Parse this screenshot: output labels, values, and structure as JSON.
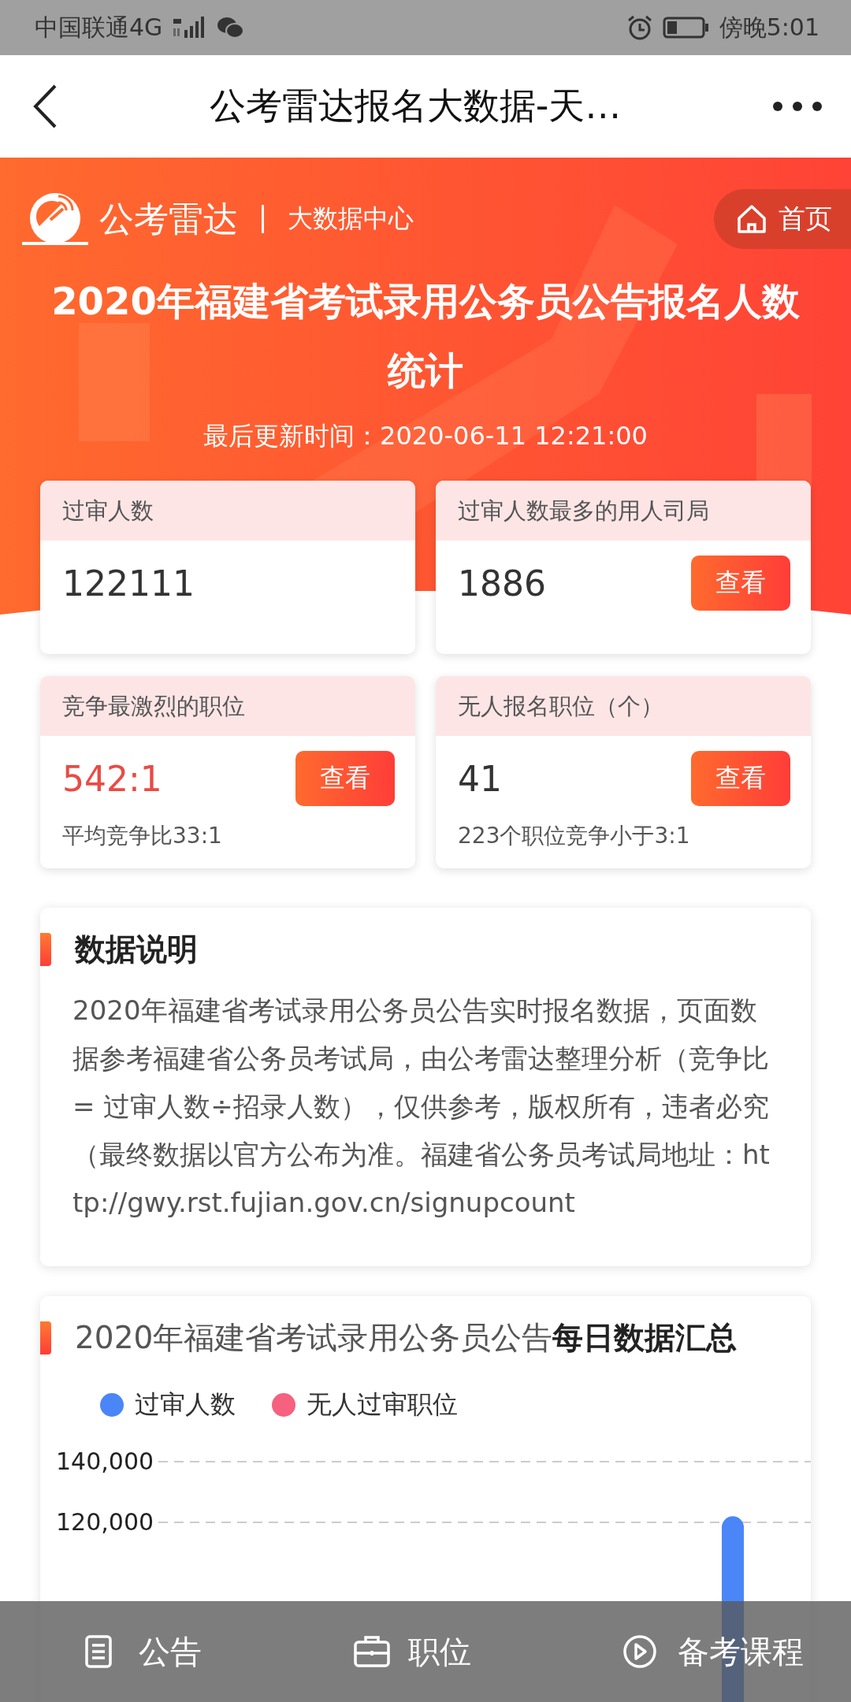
{
  "status_bar": {
    "carrier": "中国联通4G",
    "time": "傍晚5:01"
  },
  "nav": {
    "title": "公考雷达报名大数据-天…"
  },
  "header": {
    "brand": "公考雷达",
    "section": "大数据中心",
    "home": "首页",
    "title": "2020年福建省考试录用公务员公告报名人数统计",
    "updated": "最后更新时间：2020-06-11 12:21:00"
  },
  "stats": [
    {
      "label": "过审人数",
      "value": "122111",
      "highlight": false
    },
    {
      "label": "过审人数最多的用人司局",
      "value": "1886",
      "highlight": false,
      "button": "查看"
    },
    {
      "label": "竞争最激烈的职位",
      "value": "542:1",
      "highlight": true,
      "button": "查看",
      "note": "平均竞争比33:1"
    },
    {
      "label": "无人报名职位（个）",
      "value": "41",
      "highlight": false,
      "button": "查看",
      "note": "223个职位竞争小于3:1"
    }
  ],
  "notice": {
    "title": "数据说明",
    "text": "2020年福建省考试录用公务员公告实时报名数据，页面数据参考福建省公务员考试局，由公考雷达整理分析（竞争比 = 过审人数÷招录人数），仅供参考，版权所有，违者必究（最终数据以官方公布为准。福建省公务员考试局地址：http://gwy.rst.fujian.gov.cn/signupcount"
  },
  "daily": {
    "title": "2020年福建省考试录用公务员公告**每日数据汇总**",
    "chart_data": {
      "type": "bar",
      "ylim": [
        0,
        140000
      ],
      "yticks": [
        {
          "value": 140000,
          "label": "140,000"
        },
        {
          "value": 120000,
          "label": "120,000"
        }
      ],
      "series": [
        {
          "name": "过审人数",
          "color": "#4a86f7",
          "values": [
            122000
          ]
        },
        {
          "name": "无人过审职位",
          "color": "#f5617e",
          "values": [
            null
          ]
        }
      ]
    }
  },
  "bottom_nav": [
    {
      "label": "公告",
      "kind": "doc"
    },
    {
      "label": "职位",
      "kind": "case"
    },
    {
      "label": "备考课程",
      "kind": "play"
    }
  ]
}
